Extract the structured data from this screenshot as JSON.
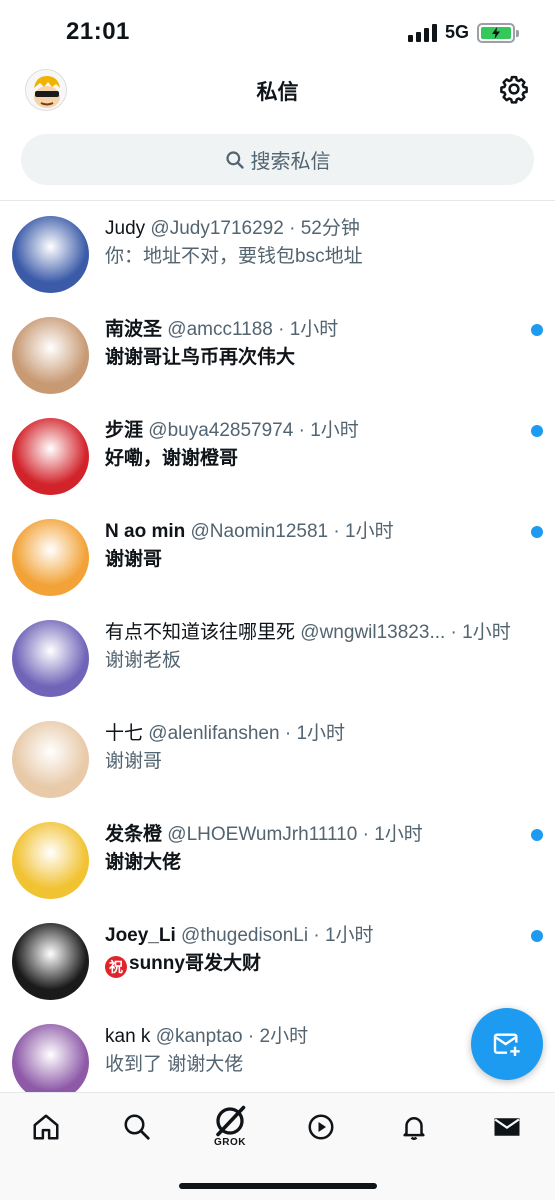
{
  "status_bar": {
    "time": "21:01",
    "network": "5G"
  },
  "header": {
    "title": "私信"
  },
  "search": {
    "placeholder": "搜索私信"
  },
  "conversations": [
    {
      "name": "Judy",
      "handle": "@Judy1716292",
      "time": "52分钟",
      "preview": "你：地址不对，要钱包bsc地址",
      "unread": false,
      "avatar_color": "#3b5ba9"
    },
    {
      "name": "南波圣",
      "handle": "@amcc1188",
      "time": "1小时",
      "preview": "谢谢哥让鸟币再次伟大",
      "unread": true,
      "avatar_color": "#c89a74"
    },
    {
      "name": "步涯",
      "handle": "@buya42857974",
      "time": "1小时",
      "preview": "好嘞，谢谢橙哥",
      "unread": true,
      "avatar_color": "#d2232a"
    },
    {
      "name": "N ao min",
      "handle": "@Naomin12581",
      "time": "1小时",
      "preview": "谢谢哥",
      "unread": true,
      "avatar_color": "#f2a236"
    },
    {
      "name": "有点不知道该往哪里死",
      "handle": "@wngwil13823...",
      "time": "1小时",
      "preview": "谢谢老板",
      "unread": false,
      "avatar_color": "#6f64b8"
    },
    {
      "name": "十七",
      "handle": "@alenlifanshen",
      "time": "1小时",
      "preview": "谢谢哥",
      "unread": false,
      "avatar_color": "#e8c9a8"
    },
    {
      "name": "发条橙",
      "handle": "@LHOEWumJrh11110",
      "time": "1小时",
      "preview": "谢谢大佬",
      "unread": true,
      "avatar_color": "#f1c232"
    },
    {
      "name": "Joey_Li",
      "handle": "@thugedisonLi",
      "time": "1小时",
      "preview": "sunny哥发大财",
      "preview_badge": "祝",
      "unread": true,
      "avatar_color": "#1a1a1a"
    },
    {
      "name": "kan k",
      "handle": "@kanptao",
      "time": "2小时",
      "preview": "收到了 谢谢大佬",
      "unread": false,
      "avatar_color": "#8e5aa8"
    }
  ],
  "tabbar": {
    "grok_label": "GROK"
  },
  "colors": {
    "accent": "#1d9bf0",
    "secondary_text": "#536471"
  }
}
